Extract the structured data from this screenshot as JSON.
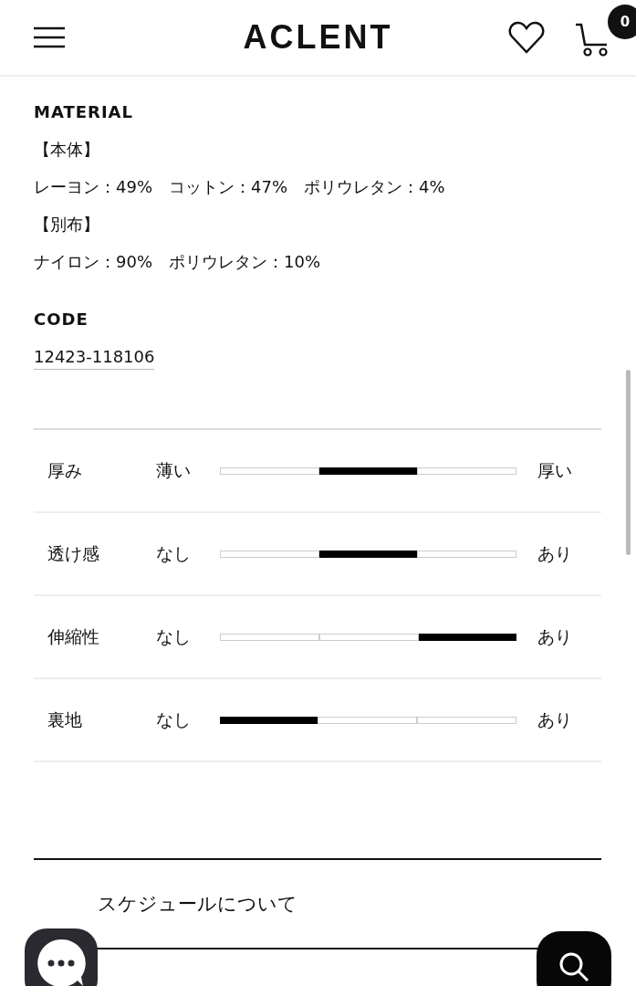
{
  "header": {
    "logo": "ACLENT",
    "cart_count": "0"
  },
  "material": {
    "heading": "MATERIAL",
    "lines": [
      "【本体】",
      "レーヨン：49%　コットン：47%　ポリウレタン：4%",
      "【別布】",
      "ナイロン：90%　ポリウレタン：10%"
    ]
  },
  "code": {
    "heading": "CODE",
    "value": "12423-118106"
  },
  "scales": [
    {
      "name": "厚み",
      "left": "薄い",
      "right": "厚い",
      "segments": [
        {
          "selected": false
        },
        {
          "selected": true
        },
        {
          "selected": false
        }
      ]
    },
    {
      "name": "透け感",
      "left": "なし",
      "right": "あり",
      "segments": [
        {
          "selected": false
        },
        {
          "selected": true
        },
        {
          "selected": false
        }
      ]
    },
    {
      "name": "伸縮性",
      "left": "なし",
      "right": "あり",
      "segments": [
        {
          "selected": false
        },
        {
          "selected": false
        },
        {
          "selected": true
        }
      ]
    },
    {
      "name": "裏地",
      "left": "なし",
      "right": "あり",
      "segments": [
        {
          "selected": true
        },
        {
          "selected": false
        },
        {
          "selected": false
        }
      ]
    }
  ],
  "accordion": {
    "title": "スケジュールについて"
  }
}
